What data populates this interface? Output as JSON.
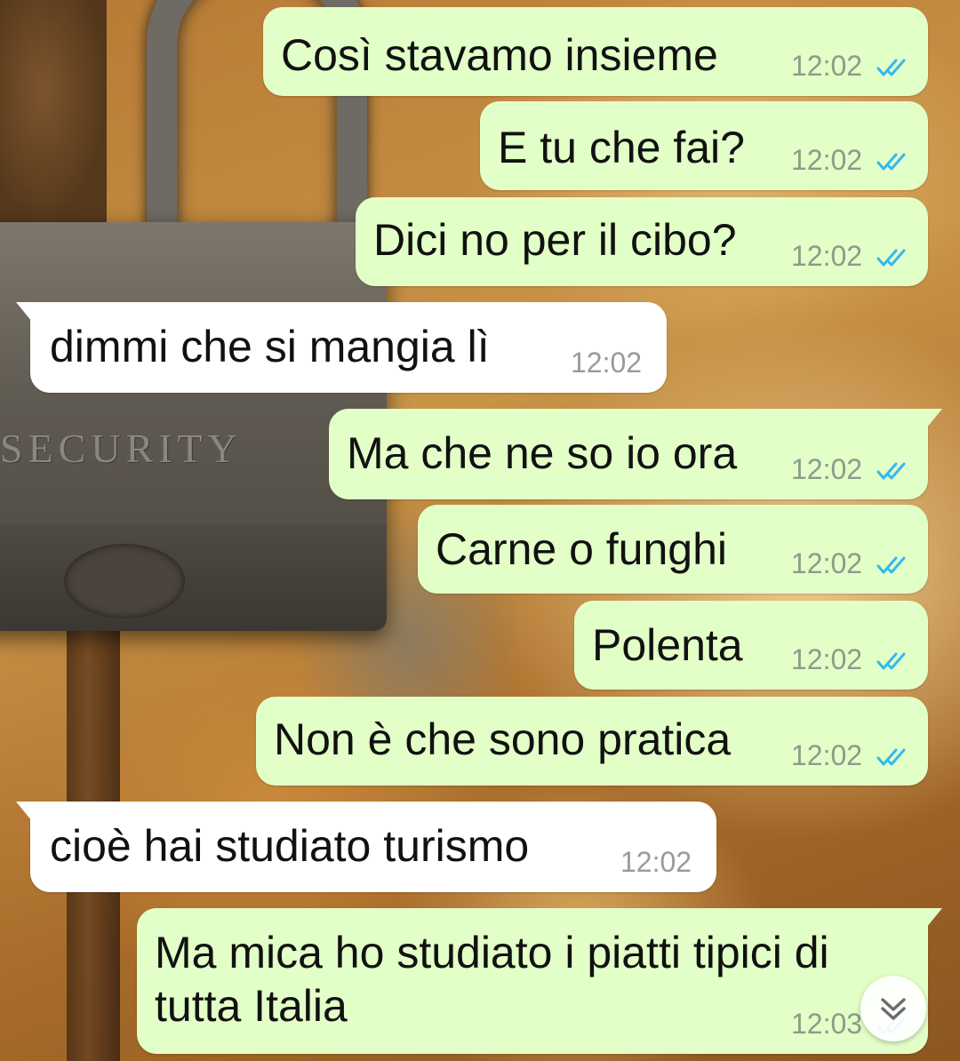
{
  "messages": [
    {
      "text": "Così stavamo insieme",
      "time": "12:02"
    },
    {
      "text": "E tu che fai?",
      "time": "12:02"
    },
    {
      "text": "Dici no per il cibo?",
      "time": "12:02"
    },
    {
      "text": "dimmi che si mangia lì",
      "time": "12:02"
    },
    {
      "text": "Ma che ne so io ora",
      "time": "12:02"
    },
    {
      "text": "Carne o funghi",
      "time": "12:02"
    },
    {
      "text": "Polenta",
      "time": "12:02"
    },
    {
      "text": "Non è che sono pratica",
      "time": "12:02"
    },
    {
      "text": "cioè hai studiato turismo",
      "time": "12:02"
    },
    {
      "text": "Ma mica ho studiato i piatti tipici di tutta Italia",
      "time": "12:03"
    }
  ],
  "wallpaper": {
    "engraving": "SECURITY"
  },
  "icons": {
    "read_receipt": "double-check-icon",
    "scroll_down": "chevron-double-down-icon"
  },
  "colors": {
    "outgoing_bubble": "#e2ffc7",
    "incoming_bubble": "#ffffff",
    "read_ticks": "#34b7f1"
  }
}
